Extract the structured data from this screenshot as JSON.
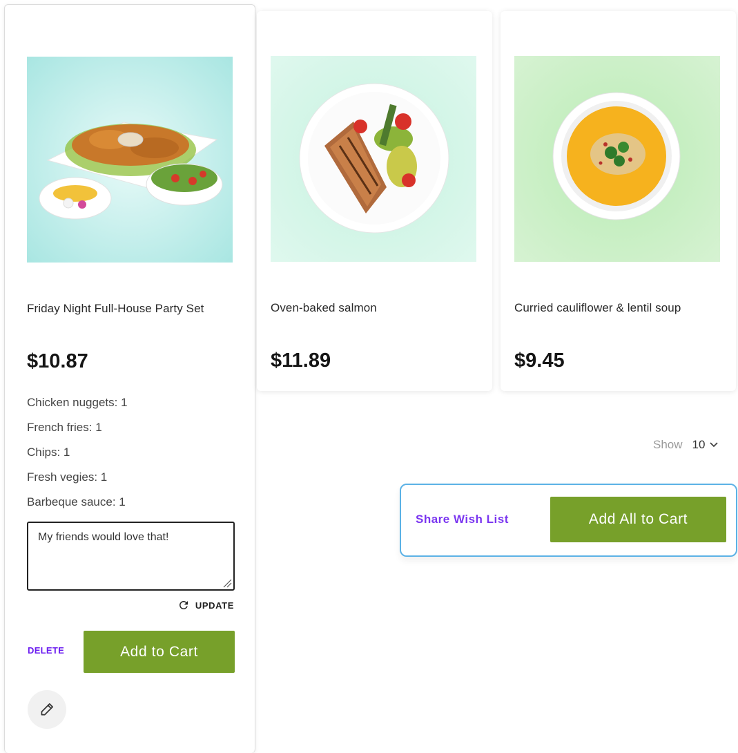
{
  "products": [
    {
      "name": "Friday Night Full-House Party Set",
      "price": "$10.87",
      "image_icon": "party-set-photo",
      "items": [
        "Chicken nuggets: 1",
        "French fries: 1",
        "Chips: 1",
        "Fresh vegies: 1",
        "Barbeque sauce: 1"
      ],
      "note": "My friends would love that!",
      "update_label": "UPDATE",
      "delete_label": "DELETE",
      "add_to_cart_label": "Add to Cart"
    },
    {
      "name": "Oven-baked salmon",
      "price": "$11.89",
      "image_icon": "salmon-plate-photo"
    },
    {
      "name": "Curried cauliflower & lentil soup",
      "price": "$9.45",
      "image_icon": "soup-bowl-photo"
    }
  ],
  "pager": {
    "show_label": "Show",
    "show_value": "10"
  },
  "wishlist": {
    "share_label": "Share Wish List",
    "add_all_label": "Add All to Cart"
  },
  "colors": {
    "accent_green": "#77a02a",
    "link_purple": "#7a35f0",
    "focus_blue": "#5cb2e6"
  }
}
